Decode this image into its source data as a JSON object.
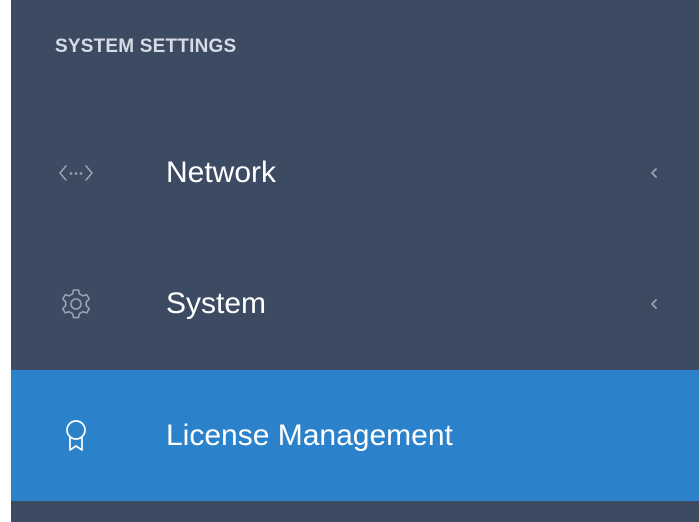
{
  "sidebar": {
    "section_header": "SYSTEM SETTINGS",
    "items": [
      {
        "label": "Network",
        "icon": "code-brackets-icon",
        "has_submenu": true,
        "active": false
      },
      {
        "label": "System",
        "icon": "gear-icon",
        "has_submenu": true,
        "active": false
      },
      {
        "label": "License Management",
        "icon": "award-ribbon-icon",
        "has_submenu": false,
        "active": true
      }
    ]
  },
  "colors": {
    "sidebar_bg": "#3c4a62",
    "active_bg": "#2b82cb",
    "header_text": "#d6dce6",
    "item_text": "#ffffff",
    "icon_muted": "#9aa3b3"
  }
}
